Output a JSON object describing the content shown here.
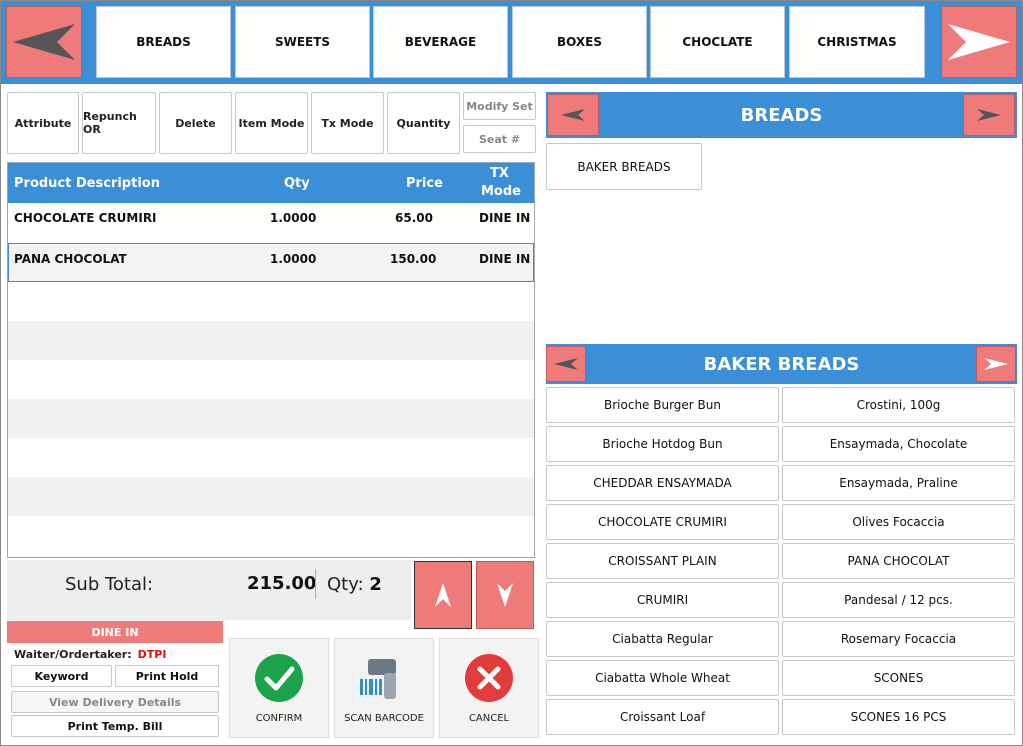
{
  "categories": [
    "BREADS",
    "SWEETS",
    "BEVERAGE",
    "BOXES",
    "CHOCLATE",
    "CHRISTMAS"
  ],
  "toolbar": {
    "attribute": "Attribute",
    "repunch": "Repunch OR",
    "delete": "Delete",
    "item_mode": "Item Mode",
    "tx_mode": "Tx Mode",
    "quantity": "Quantity",
    "modify_set": "Modify Set",
    "seat": "Seat #"
  },
  "table": {
    "headers": {
      "description": "Product Description",
      "qty": "Qty",
      "price": "Price",
      "tx_mode_1": "TX",
      "tx_mode_2": "Mode"
    },
    "rows": [
      {
        "description": "CHOCOLATE  CRUMIRI",
        "qty": "1.0000",
        "price": "65.00",
        "mode": "DINE IN"
      },
      {
        "description": "PANA CHOCOLAT",
        "qty": "1.0000",
        "price": "150.00",
        "mode": "DINE IN"
      }
    ]
  },
  "totals": {
    "subtotal_label": "Sub Total:",
    "subtotal_value": "215.00",
    "qty_label": "Qty:",
    "qty_value": "2"
  },
  "bottom_left": {
    "mode_banner": "DINE IN",
    "waiter_label": "Waiter/Ordertaker:",
    "waiter_code": "DTPI",
    "keyword": "Keyword",
    "print_hold": "Print Hold",
    "view_delivery": "View Delivery Details",
    "print_temp": "Print Temp. Bill"
  },
  "actions": {
    "confirm": "CONFIRM",
    "scan": "SCAN BARCODE",
    "cancel": "CANCEL"
  },
  "category_panel": {
    "title": "BREADS",
    "subcategories": [
      "BAKER BREADS"
    ]
  },
  "product_panel": {
    "title": "BAKER BREADS",
    "products": [
      "Brioche Burger Bun",
      "Crostini, 100g",
      "Brioche Hotdog Bun",
      "Ensaymada, Chocolate",
      "CHEDDAR ENSAYMADA",
      "Ensaymada, Praline",
      "CHOCOLATE  CRUMIRI",
      "Olives Focaccia",
      "CROISSANT PLAIN",
      "PANA CHOCOLAT",
      "CRUMIRI",
      "Pandesal / 12 pcs.",
      "Ciabatta Regular",
      "Rosemary Focaccia",
      "Ciabatta Whole Wheat",
      "SCONES",
      "Croissant Loaf",
      "SCONES 16 PCS"
    ]
  },
  "colors": {
    "accent_blue": "#3a8fd6",
    "nav_red": "#ef7a7a",
    "confirm_green": "#1aa34a",
    "cancel_red": "#e23b3b"
  }
}
